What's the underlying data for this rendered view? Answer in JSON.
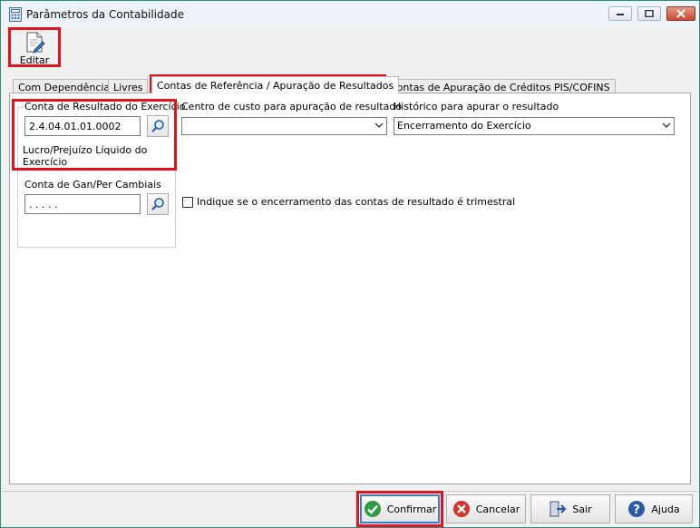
{
  "window": {
    "title": "Parâmetros da Contabilidade"
  },
  "toolbar": {
    "edit_label": "Editar"
  },
  "tabs": [
    {
      "label": "Com Dependência",
      "active": false
    },
    {
      "label": "Livres",
      "active": false
    },
    {
      "label": "Contas de Referência / Apuração de Resultados",
      "active": true
    },
    {
      "label": "Contas de Apuração de Créditos PIS/COFINS",
      "active": false
    }
  ],
  "result_account": {
    "legend": "Conta de Resultado do Exercício",
    "value": "2.4.04.01.01.0002",
    "description_line1": "Lucro/Prejuízo Líquido do",
    "description_line2": "Exercício"
  },
  "cost_center": {
    "label": "Centro de custo para apuração de resultado",
    "value": ""
  },
  "history": {
    "label": "Histórico para apurar o resultado",
    "value": "Encerramento do Exercício"
  },
  "exchange_account": {
    "legend": "Conta de Gan/Per Cambiais",
    "value": ". . . . ."
  },
  "quarterly_checkbox": {
    "label": "Indique se o encerramento das contas de resultado é trimestral",
    "checked": false
  },
  "buttons": {
    "confirm": "Confirmar",
    "cancel": "Cancelar",
    "exit": "Sair",
    "help": "Ajuda"
  },
  "colors": {
    "highlight": "#e3141d",
    "confirm_green": "#2e9b43",
    "cancel_red": "#d7342b",
    "help_blue": "#2b5aa8"
  }
}
